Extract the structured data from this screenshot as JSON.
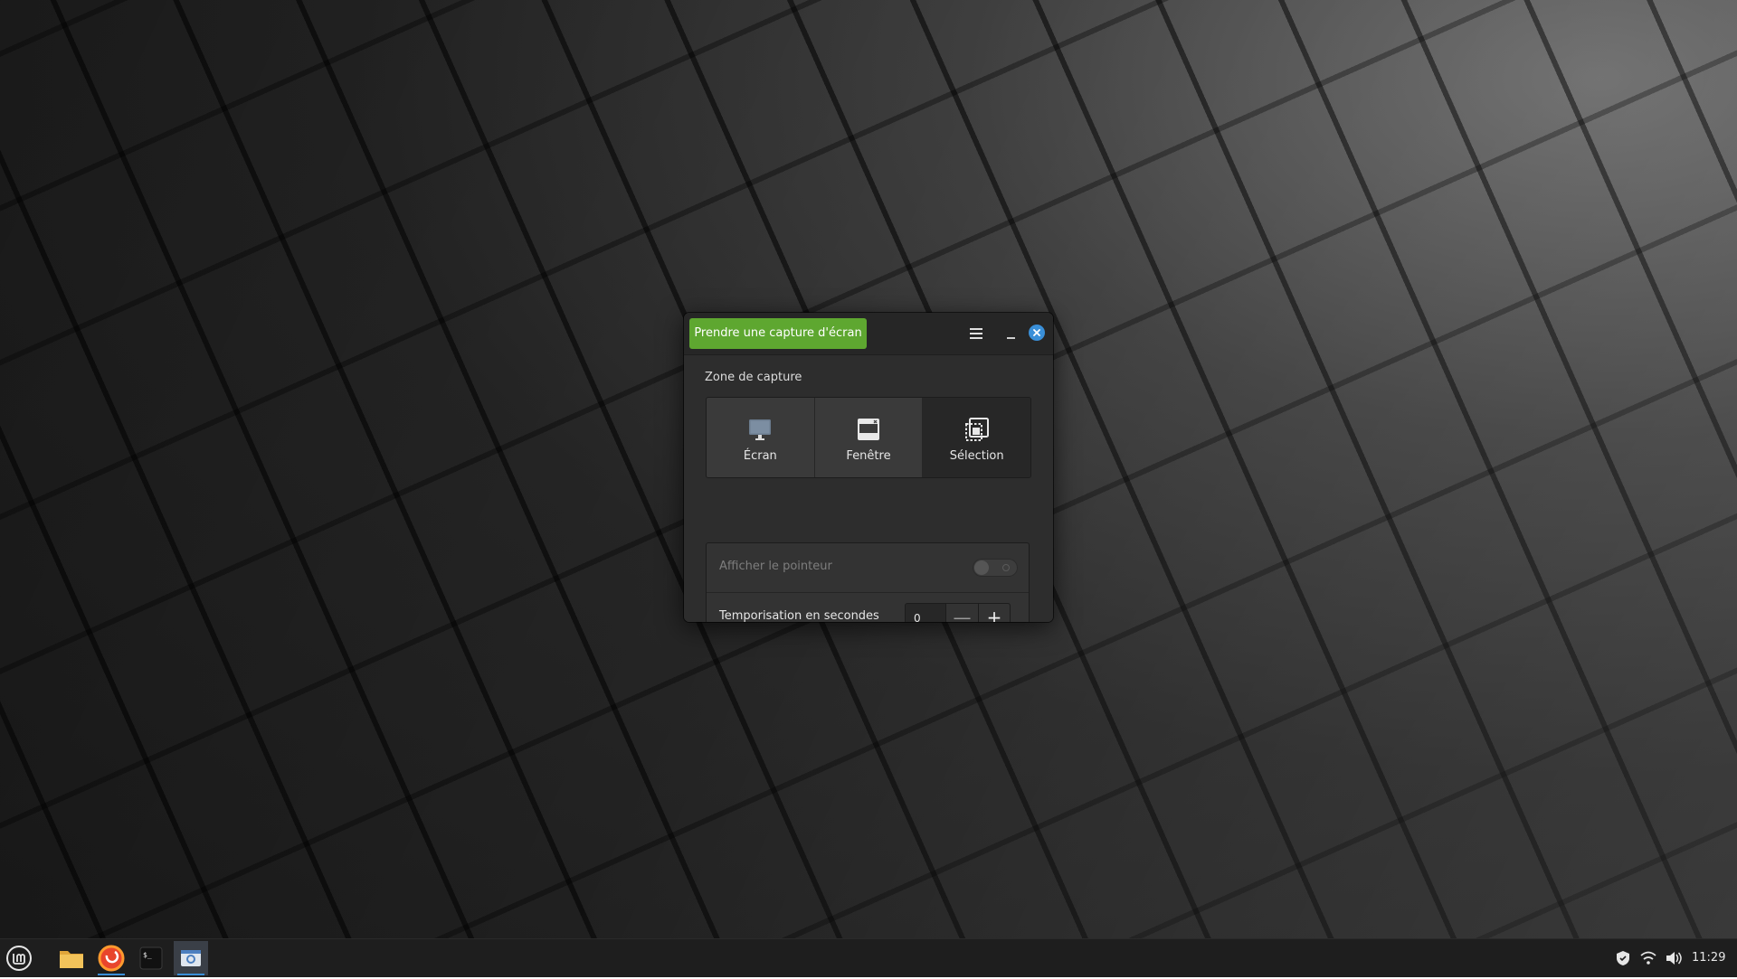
{
  "window": {
    "take_button_label": "Prendre une capture d'écran",
    "section_label": "Zone de capture",
    "zones": [
      {
        "label": "Écran",
        "icon": "monitor-icon",
        "selected": false
      },
      {
        "label": "Fenêtre",
        "icon": "window-icon",
        "selected": false
      },
      {
        "label": "Sélection",
        "icon": "selection-icon",
        "selected": true
      }
    ],
    "pointer_label": "Afficher le pointeur",
    "pointer_enabled": false,
    "delay_label": "Temporisation en secondes",
    "delay_value": "0",
    "minus_symbol": "—",
    "plus_symbol": "+"
  },
  "taskbar": {
    "apps": [
      {
        "name": "files",
        "icon": "folder-icon"
      },
      {
        "name": "browser",
        "icon": "firefox-icon"
      },
      {
        "name": "terminal",
        "icon": "terminal-icon"
      },
      {
        "name": "screenshot",
        "icon": "camera-icon",
        "active": true
      }
    ],
    "tray": [
      "shield-icon",
      "wifi-icon",
      "volume-icon"
    ],
    "clock": "11:29"
  },
  "colors": {
    "accent_green": "#5ea730",
    "accent_blue": "#3a8fd8"
  }
}
